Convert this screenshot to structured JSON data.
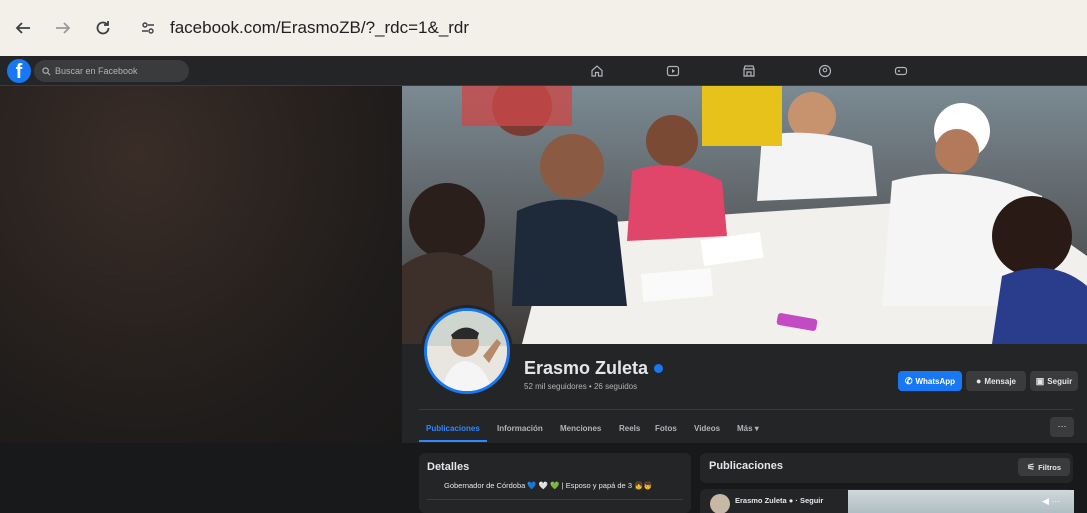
{
  "browser": {
    "url": "facebook.com/ErasmoZB/?_rdc=1&_rdr",
    "back_icon": "arrow-left-icon",
    "forward_icon": "arrow-right-icon",
    "reload_icon": "reload-icon"
  },
  "facebook": {
    "logo": "f",
    "search_placeholder": "Buscar en Facebook",
    "nav_icons": [
      "home-icon",
      "video-icon",
      "marketplace-icon",
      "groups-icon",
      "gaming-icon"
    ]
  },
  "profile": {
    "name": "Erasmo Zuleta",
    "stats": "52 mil seguidores • 26 seguidos",
    "buttons": {
      "whatsapp": "WhatsApp",
      "message": "Mensaje",
      "follow": "Seguir"
    },
    "tabs": [
      "Publicaciones",
      "Información",
      "Menciones",
      "Reels",
      "Fotos",
      "Videos",
      "Más ▾"
    ],
    "more_label": "···"
  },
  "details": {
    "title": "Detalles",
    "bio": "Gobernador de Córdoba 💙 🤍 💚 | Esposo y papá de 3 👧👦"
  },
  "posts": {
    "title": "Publicaciones",
    "filter_label": "Filtros",
    "post_author": "Erasmo Zuleta ● · Seguir"
  },
  "colors": {
    "accent": "#1877f2",
    "background": "#18191a",
    "surface": "#242526"
  }
}
